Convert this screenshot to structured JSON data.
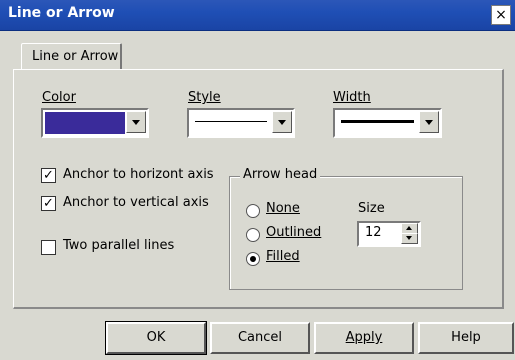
{
  "window": {
    "title": "Line or Arrow",
    "close_label": "×"
  },
  "tab": {
    "label": "Line or Arrow"
  },
  "fields": {
    "color_label": "Color",
    "style_label": "Style",
    "width_label": "Width",
    "color_value": "#3a2b9a"
  },
  "checkboxes": {
    "anchor_horizontal": "Anchor to horizont axis",
    "anchor_vertical": "Anchor to vertical axis",
    "parallel_lines": "Two parallel lines",
    "check_mark": "✓"
  },
  "arrow_head": {
    "title": "Arrow head",
    "none": "None",
    "outlined": "Outlined",
    "filled": "Filled",
    "size_label": "Size",
    "size_value": "12"
  },
  "buttons": {
    "ok": "OK",
    "cancel": "Cancel",
    "apply": "Apply",
    "help": "Help"
  },
  "icons": {
    "close": "close-icon",
    "dropdown": "chevron-down-icon",
    "spin_up": "chevron-up-icon",
    "spin_down": "chevron-down-icon"
  }
}
